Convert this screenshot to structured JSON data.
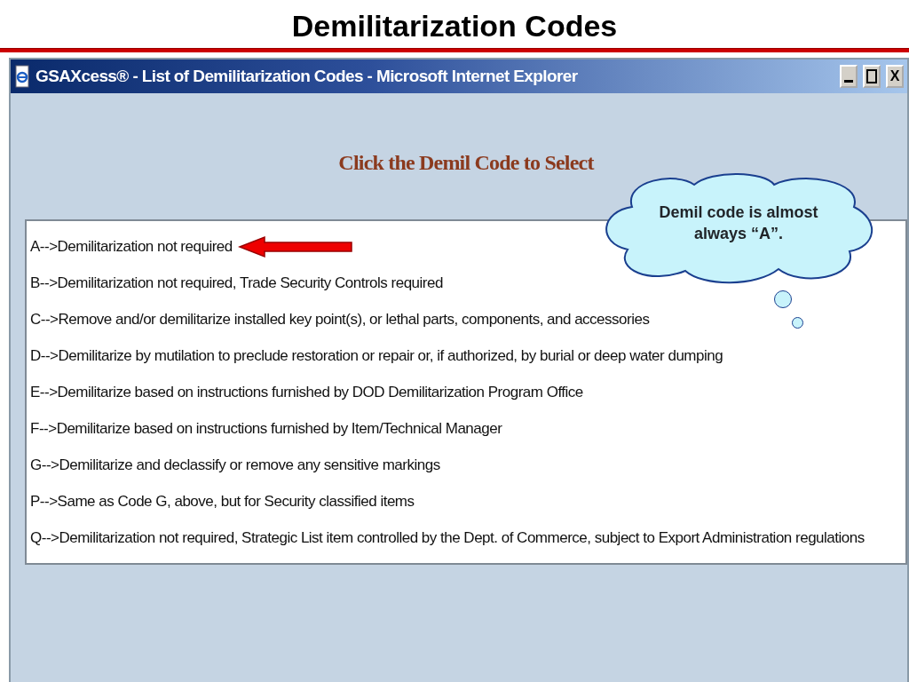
{
  "slide_title": "Demilitarization Codes",
  "window": {
    "title": "GSAXcess® - List of Demilitarization Codes - Microsoft Internet Explorer",
    "close_label": "X"
  },
  "page_heading": "Click the Demil Code to Select",
  "codes": [
    {
      "text": "A-->Demilitarization not required",
      "pointed": true
    },
    {
      "text": "B-->Demilitarization not required, Trade Security Controls required",
      "pointed": false
    },
    {
      "text": "C-->Remove and/or demilitarize installed key point(s), or lethal parts, components, and accessories",
      "pointed": false
    },
    {
      "text": "D-->Demilitarize by mutilation to preclude restoration or repair or, if authorized, by burial or deep water dumping",
      "pointed": false
    },
    {
      "text": "E-->Demilitarize based on instructions furnished by DOD Demilitarization Program Office",
      "pointed": false
    },
    {
      "text": "F-->Demilitarize based on instructions furnished by Item/Technical Manager",
      "pointed": false
    },
    {
      "text": "G-->Demilitarize and declassify or remove any sensitive markings",
      "pointed": false
    },
    {
      "text": "P-->Same as Code G, above, but for Security classified items",
      "pointed": false
    },
    {
      "text": "Q-->Demilitarization not required, Strategic List item controlled by the Dept. of Commerce, subject to Export Administration regulations",
      "pointed": false
    }
  ],
  "callout": {
    "text": "Demil code is almost always “A”."
  }
}
